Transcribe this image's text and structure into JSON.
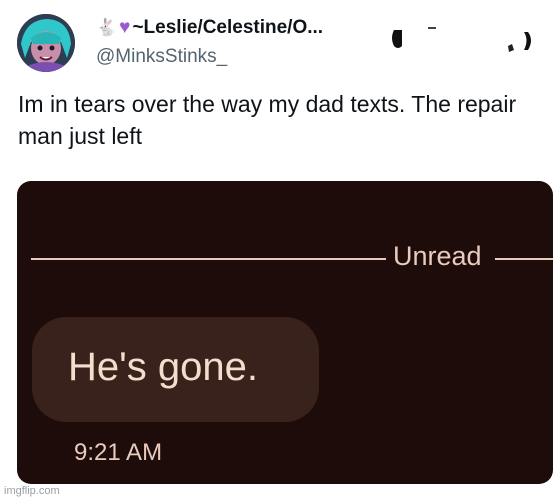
{
  "tweet": {
    "display_name": "~Leslie/Celestine/O...",
    "name_emojis": [
      "rabbit-emoji",
      "purple-heart-emoji"
    ],
    "handle": "@MinksStinks_",
    "text": "Im in tears over the way my dad texts. The repair man just left"
  },
  "message_card": {
    "divider_label": "Unread",
    "message_text": "He's gone.",
    "timestamp": "9:21 AM"
  },
  "watermark": "imgflip.com",
  "colors": {
    "card_background": "#1e0c0a",
    "bubble_background": "#3a221c",
    "accent_text": "#e9cbbd",
    "heart": "#9b59d0"
  }
}
